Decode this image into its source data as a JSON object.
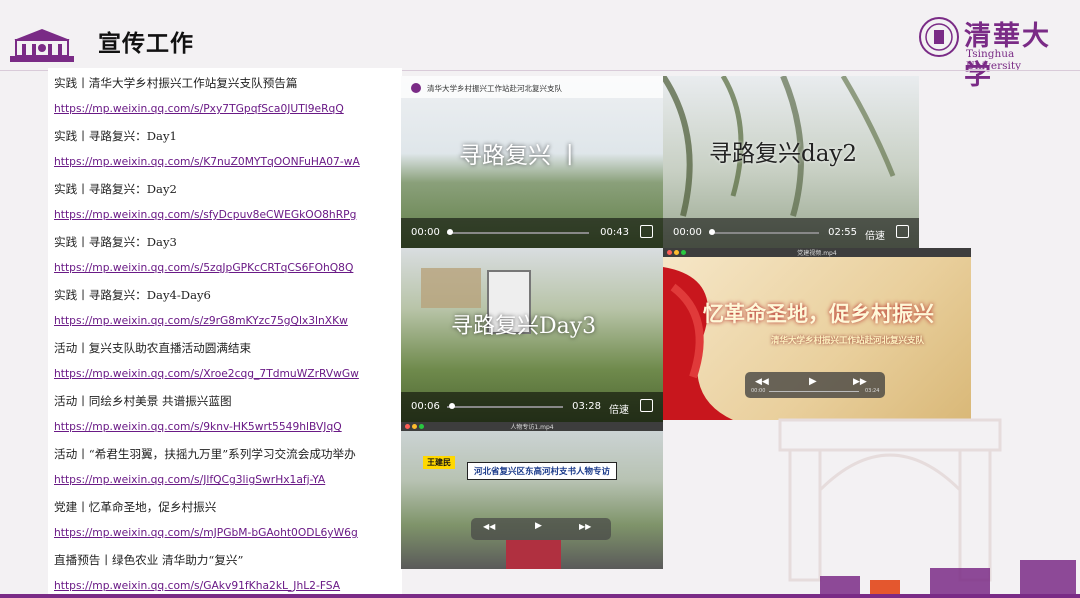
{
  "header": {
    "title": "宣传工作",
    "brand_cn": "清華大学",
    "brand_en": "Tsinghua University"
  },
  "list": [
    {
      "type": "t",
      "text": "实践丨清华大学乡村振兴工作站复兴支队预告篇"
    },
    {
      "type": "l",
      "text": "https://mp.weixin.qq.com/s/Pxy7TGpqfSca0JUTl9eRqQ"
    },
    {
      "type": "t",
      "text": "实践丨寻路复兴：Day1"
    },
    {
      "type": "l",
      "text": "https://mp.weixin.qq.com/s/K7nuZ0MYTqOONFuHA07-wA"
    },
    {
      "type": "t",
      "text": "实践丨寻路复兴：Day2"
    },
    {
      "type": "l",
      "text": "https://mp.weixin.qq.com/s/sfyDcpuv8eCWEGkOO8hRPg"
    },
    {
      "type": "t",
      "text": "实践丨寻路复兴：Day3"
    },
    {
      "type": "l",
      "text": "https://mp.weixin.qq.com/s/5zqJpGPKcCRTqCS6FOhQ8Q"
    },
    {
      "type": "t",
      "text": "实践丨寻路复兴：Day4-Day6"
    },
    {
      "type": "l",
      "text": "https://mp.weixin.qq.com/s/z9rG8mKYzc75gQlx3lnXKw"
    },
    {
      "type": "t",
      "text": "活动丨复兴支队助农直播活动圆满结束"
    },
    {
      "type": "l",
      "text": "https://mp.weixin.qq.com/s/Xroe2cqg_7TdmuWZrRVwGw"
    },
    {
      "type": "t",
      "text": "活动丨同绘乡村美景 共谱振兴蓝图"
    },
    {
      "type": "l",
      "text": "https://mp.weixin.qq.com/s/9knv-HK5wrt5549hlBVJqQ"
    },
    {
      "type": "t",
      "text": "活动丨“希君生羽翼，扶摇九万里”系列学习交流会成功举办"
    },
    {
      "type": "l",
      "text": "https://mp.weixin.qq.com/s/JlfQCg3ligSwrHx1afj-YA"
    },
    {
      "type": "t",
      "text": "党建丨忆革命圣地，促乡村振兴"
    },
    {
      "type": "l",
      "text": "https://mp.weixin.qq.com/s/mJPGbM-bGAoht0ODL6yW6g"
    },
    {
      "type": "t",
      "text": "直播预告丨绿色农业 清华助力“复兴”"
    },
    {
      "type": "l",
      "text": "https://mp.weixin.qq.com/s/GAkv91fKha2kL_JhL2-FSA"
    }
  ],
  "videos": {
    "v1": {
      "caption": "清华大学乡村振兴工作站赴河北复兴支队",
      "title": "寻路复兴 丨",
      "current": "00:00",
      "duration": "00:43"
    },
    "v2": {
      "title": "寻路复兴day2",
      "current": "00:00",
      "duration": "02:55",
      "speed": "倍速"
    },
    "v3": {
      "title": "寻路复兴Day3",
      "current": "00:06",
      "duration": "03:28",
      "speed": "倍速"
    },
    "v4": {
      "window_title": "党建视频.mp4",
      "headline": "忆革命圣地，促乡村振兴",
      "sub": "清华大学乡村振兴工作站赴河北复兴支队",
      "current": "00:00",
      "duration": "03:24"
    },
    "v5": {
      "window_title": "人物专访1.mp4",
      "tag": "王建民",
      "headline": "河北省复兴区东高河村支书人物专访"
    }
  }
}
